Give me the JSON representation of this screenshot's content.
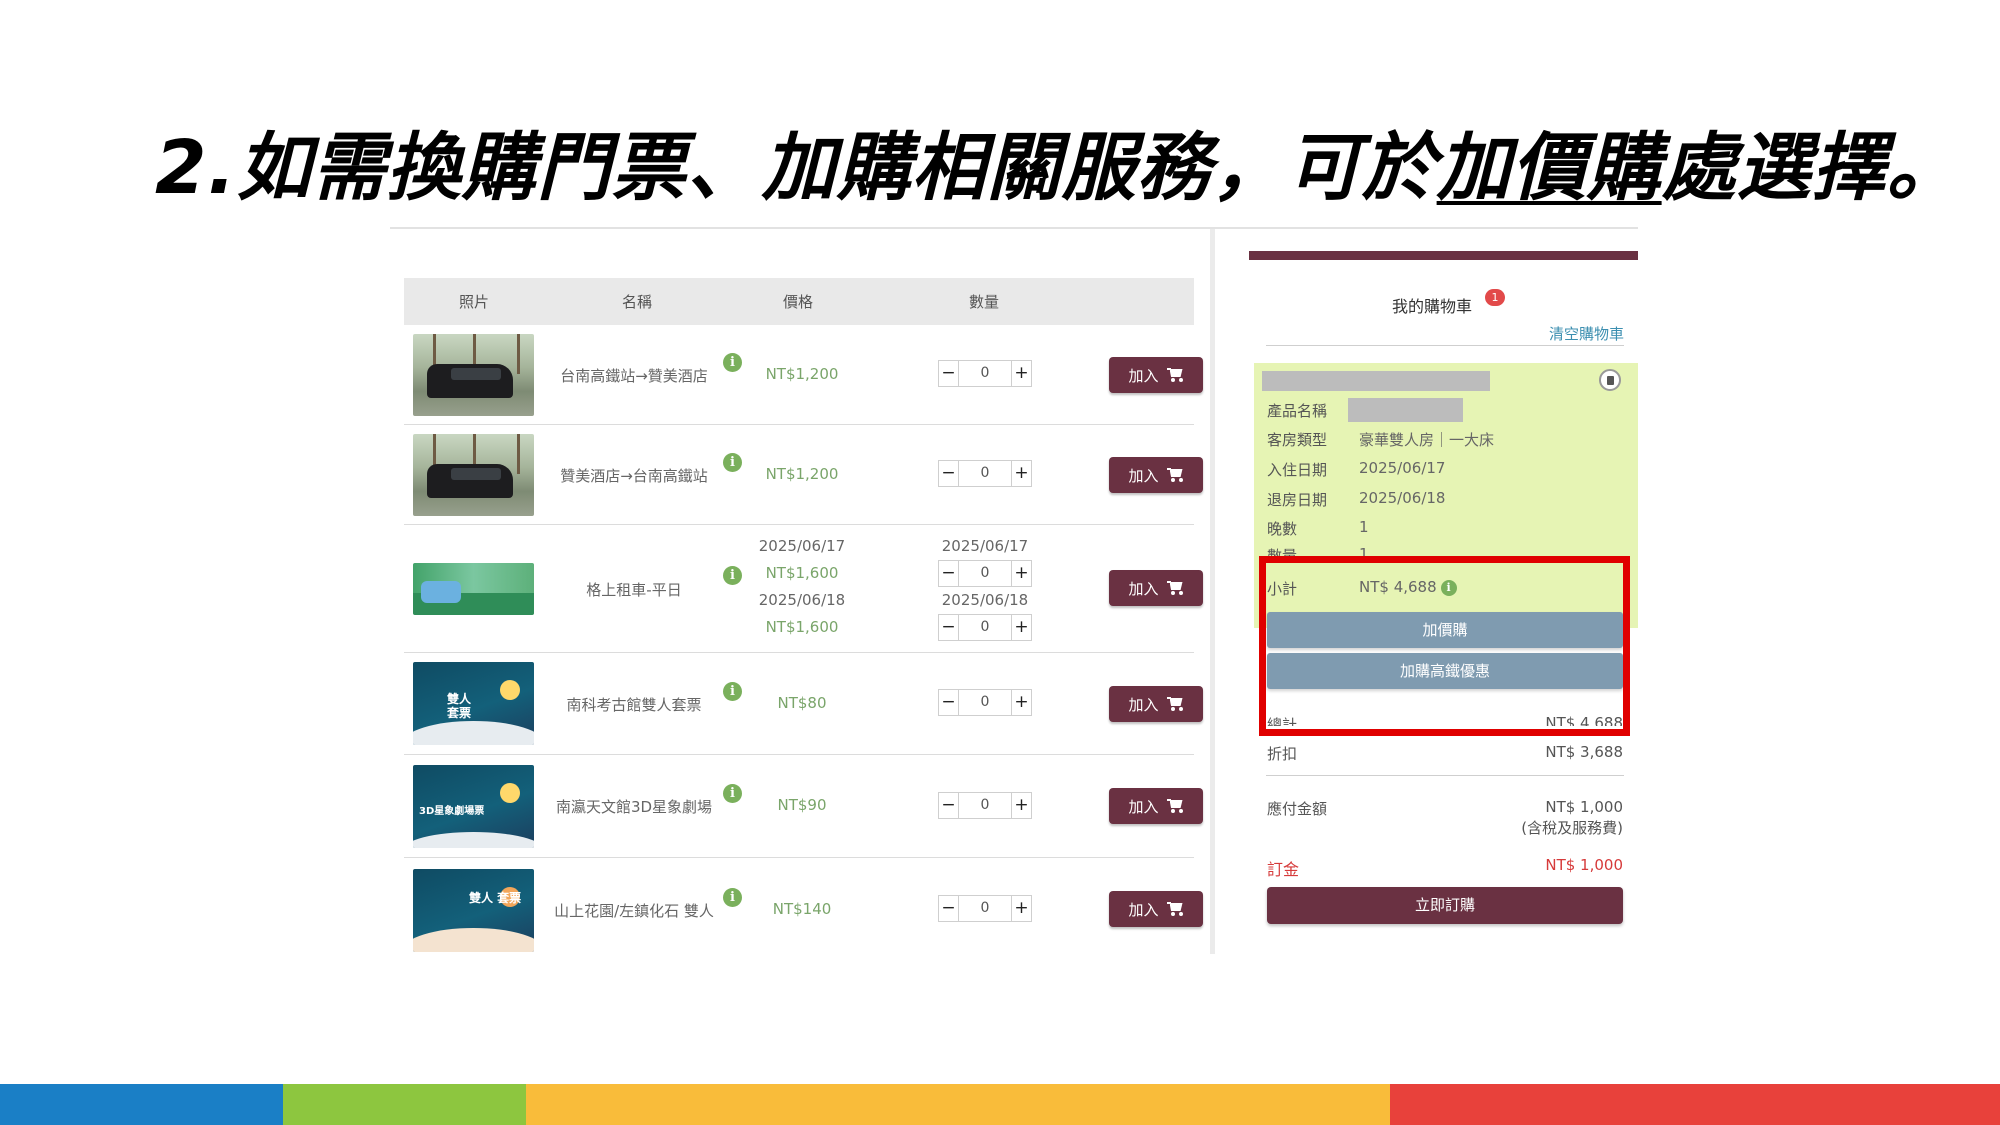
{
  "slide": {
    "title_before": "2.如需換購門票、加購相關服務，可於",
    "title_underlined": "加價購",
    "title_after": "處選擇。"
  },
  "table": {
    "headers": [
      "照片",
      "名稱",
      "價格",
      "數量"
    ],
    "add_label": "加入",
    "rows": [
      {
        "name": "台南高鐵站→贊美酒店",
        "price": "NT$1,200",
        "qty": "0",
        "thumb_icon": "van-photo"
      },
      {
        "name": "贊美酒店→台南高鐵站",
        "price": "NT$1,200",
        "qty": "0",
        "thumb_icon": "van-photo"
      },
      {
        "name": "格上租車-平日",
        "thumb_icon": "rental-car-banner",
        "sub": [
          {
            "date": "2025/06/17",
            "price": "NT$1,600",
            "qty": "0"
          },
          {
            "date": "2025/06/18",
            "price": "NT$1,600",
            "qty": "0"
          }
        ]
      },
      {
        "name": "南科考古館雙人套票",
        "price": "NT$80",
        "qty": "0",
        "thumb_icon": "museum-poster",
        "thumb_text": "雙人\n套票"
      },
      {
        "name": "南瀛天文館3D星象劇場",
        "price": "NT$90",
        "qty": "0",
        "thumb_icon": "observatory-poster",
        "thumb_text": "3D星象劇場票"
      },
      {
        "name": "山上花園/左鎮化石 雙人",
        "price": "NT$140",
        "qty": "0",
        "thumb_icon": "garden-poster",
        "thumb_text": "雙人\n套票"
      }
    ]
  },
  "cart": {
    "title": "我的購物車",
    "badge": "1",
    "clear_label": "清空購物車",
    "details": [
      {
        "label": "產品名稱",
        "value": ""
      },
      {
        "label": "客房類型",
        "value": "豪華雙人房｜一大床"
      },
      {
        "label": "入住日期",
        "value": "2025/06/17"
      },
      {
        "label": "退房日期",
        "value": "2025/06/18"
      },
      {
        "label": "晚數",
        "value": "1"
      },
      {
        "label": "數量",
        "value": "1"
      }
    ],
    "subtotal_label": "小計",
    "subtotal_value": "NT$ 4,688",
    "addon_button": "加價購",
    "hsr_button": "加購高鐵優惠",
    "total_label": "總計",
    "total_value": "NT$ 4,688",
    "discount_label": "折扣",
    "discount_value": "NT$ 3,688",
    "payable_label": "應付金額",
    "payable_value": "NT$ 1,000",
    "payable_note": "(含稅及服務費)",
    "deposit_label": "訂金",
    "deposit_value": "NT$ 1,000",
    "order_button": "立即訂購"
  },
  "colors": {
    "brand": "#6a3142",
    "highlight": "#e00000",
    "cart_item_bg": "#e6f4b4",
    "addon_button": "#7f9bb0",
    "price_green": "#7aa56a",
    "footer": [
      "#1a7fc6",
      "#8dc63f",
      "#f9bc3a",
      "#e8413b"
    ]
  }
}
